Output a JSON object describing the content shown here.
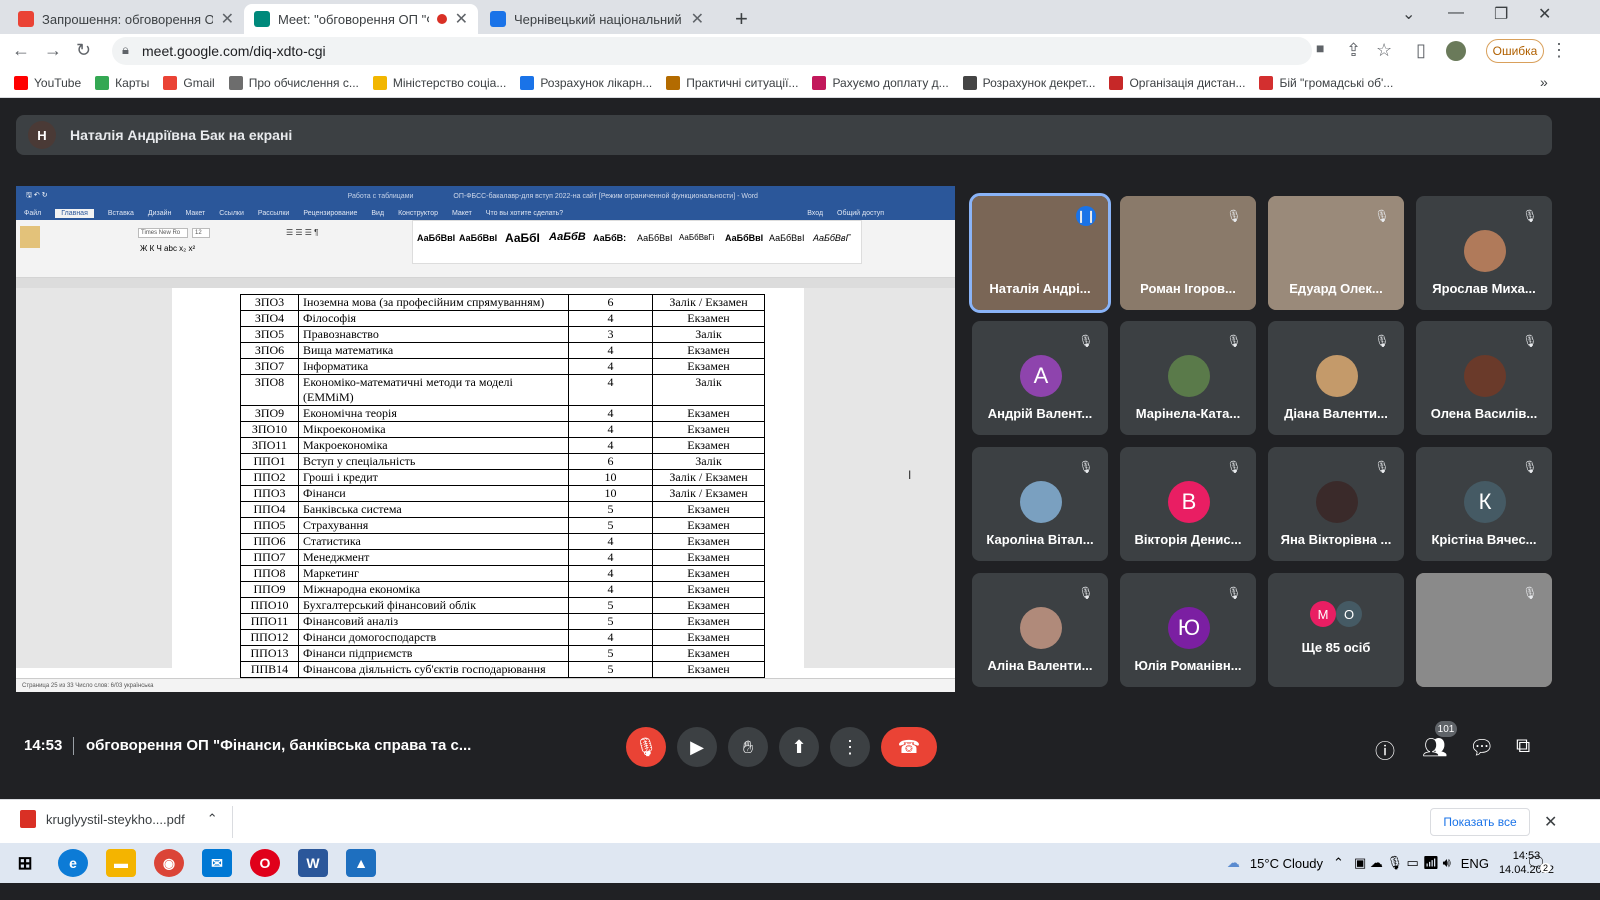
{
  "browser": {
    "tabs": [
      {
        "title": "Запрошення: обговорення ОП",
        "active": false,
        "favicon_color": "#ea4335"
      },
      {
        "title": "Meet: \"обговорення ОП \"Ф",
        "active": true,
        "favicon_color": "#00897b"
      },
      {
        "title": "Чернівецький національний ун",
        "active": false,
        "favicon_color": "#1a73e8"
      }
    ],
    "url": "meet.google.com/diq-xdto-cgi",
    "error_button": "Ошибка",
    "bookmarks": [
      {
        "label": "YouTube",
        "color": "#ff0000"
      },
      {
        "label": "Карты",
        "color": "#34a853"
      },
      {
        "label": "Gmail",
        "color": "#ea4335"
      },
      {
        "label": "Про обчислення с...",
        "color": "#6d6d6d"
      },
      {
        "label": "Міністерство соціа...",
        "color": "#f2b600"
      },
      {
        "label": "Розрахунок лікарн...",
        "color": "#1a73e8"
      },
      {
        "label": "Практичні ситуації...",
        "color": "#b36b00"
      },
      {
        "label": "Рахуємо доплату д...",
        "color": "#c2185b"
      },
      {
        "label": "Розрахунок декрет...",
        "color": "#444444"
      },
      {
        "label": "Організація дистан...",
        "color": "#c62828"
      },
      {
        "label": "Бій \"громадські об'...",
        "color": "#d32f2f"
      }
    ]
  },
  "meet": {
    "presenter_initial": "Н",
    "presenter_text": "Наталія Андріївна Бак на екрані",
    "time": "14:53",
    "meeting_title": "обговорення ОП \"Фінанси, банківська справа та с...",
    "people_count": "101",
    "participants": [
      {
        "name": "Наталія Андрі...",
        "type": "video",
        "initial": "",
        "color": "#7a6656"
      },
      {
        "name": "Роман Ігоров...",
        "type": "video",
        "initial": "",
        "color": "#8a7a6a"
      },
      {
        "name": "Едуард Олек...",
        "type": "video",
        "initial": "",
        "color": "#9a8a7a"
      },
      {
        "name": "Ярослав Миха...",
        "type": "photo",
        "initial": "",
        "color": "#b07a5a"
      },
      {
        "name": "Андрій Валент...",
        "type": "letter",
        "initial": "А",
        "color": "#8e44ad"
      },
      {
        "name": "Марінела-Ката...",
        "type": "photo",
        "initial": "",
        "color": "#5a7a4a"
      },
      {
        "name": "Діана Валенти...",
        "type": "photo",
        "initial": "",
        "color": "#c49a6a"
      },
      {
        "name": "Олена Василів...",
        "type": "photo",
        "initial": "",
        "color": "#6a3a2a"
      },
      {
        "name": "Кароліна Вітал...",
        "type": "photo",
        "initial": "",
        "color": "#7aa0c0"
      },
      {
        "name": "Вікторія Денис...",
        "type": "letter",
        "initial": "В",
        "color": "#e91e63"
      },
      {
        "name": "Яна Вікторівна ...",
        "type": "photo",
        "initial": "",
        "color": "#3a2a2a"
      },
      {
        "name": "Крістіна Вячес...",
        "type": "letter",
        "initial": "К",
        "color": "#455a64"
      },
      {
        "name": "Аліна Валенти...",
        "type": "photo",
        "initial": "",
        "color": "#b08a7a"
      },
      {
        "name": "Юлія Романівн...",
        "type": "letter",
        "initial": "Ю",
        "color": "#7b1fa2"
      },
      {
        "name": "Ще 85 осіб",
        "type": "more",
        "initial": "",
        "color": "#3c4043"
      },
      {
        "name": "",
        "type": "video",
        "initial": "",
        "color": "#8a8a8a"
      }
    ],
    "more_avatars": [
      "М",
      "О"
    ]
  },
  "word": {
    "title": "ОП-ФБСС-бакалавр-для вступ 2022-на сайт [Режим ограниченной функциональности] - Word",
    "context_tab": "Работа с таблицами",
    "ribbon_tabs": [
      "Файл",
      "Главная",
      "Вставка",
      "Дизайн",
      "Макет",
      "Ссылки",
      "Рассылки",
      "Рецензирование",
      "Вид",
      "Конструктор",
      "Макет"
    ],
    "search_hint": "Что вы хотите сделать?",
    "login": "Вход",
    "share": "Общий доступ",
    "font": "Times New Ro",
    "font_size": "12",
    "styles": [
      "АаБбВвІ",
      "АаБбВвІ",
      "АаБбІ",
      "АаБбВ",
      "АаБбВ:",
      "АаБбВвІ",
      "АаБбВвГі",
      "АаБбВвІ",
      "АаБбВвІ",
      "АаБбВвГ"
    ],
    "status": "Страница 25 из 33   Число слов: 6/03   українська",
    "rows": [
      [
        "ЗПО3",
        "Іноземна мова (за професійним спрямуванням)",
        "6",
        "Залік / Екзамен"
      ],
      [
        "ЗПО4",
        "Філософія",
        "4",
        "Екзамен"
      ],
      [
        "ЗПО5",
        "Правознавство",
        "3",
        "Залік"
      ],
      [
        "ЗПО6",
        "Вища математика",
        "4",
        "Екзамен"
      ],
      [
        "ЗПО7",
        "Інформатика",
        "4",
        "Екзамен"
      ],
      [
        "ЗПО8",
        "Економіко-математичні методи та моделі (ЕММіМ)",
        "4",
        "Залік"
      ],
      [
        "ЗПО9",
        "Економічна теорія",
        "4",
        "Екзамен"
      ],
      [
        "ЗПО10",
        "Мікроекономіка",
        "4",
        "Екзамен"
      ],
      [
        "ЗПО11",
        "Макроекономіка",
        "4",
        "Екзамен"
      ],
      [
        "ППО1",
        "Вступ у спеціальність",
        "6",
        "Залік"
      ],
      [
        "ППО2",
        "Гроші і кредит",
        "10",
        "Залік / Екзамен"
      ],
      [
        "ППО3",
        "Фінанси",
        "10",
        "Залік / Екзамен"
      ],
      [
        "ППО4",
        "Банківська система",
        "5",
        "Екзамен"
      ],
      [
        "ППО5",
        "Страхування",
        "5",
        "Екзамен"
      ],
      [
        "ППО6",
        "Статистика",
        "4",
        "Екзамен"
      ],
      [
        "ППО7",
        "Менеджмент",
        "4",
        "Екзамен"
      ],
      [
        "ППО8",
        "Маркетинг",
        "4",
        "Екзамен"
      ],
      [
        "ППО9",
        "Міжнародна економіка",
        "4",
        "Екзамен"
      ],
      [
        "ППО10",
        "Бухгалтерський фінансовий облік",
        "5",
        "Екзамен"
      ],
      [
        "ППО11",
        "Фінансовий аналіз",
        "5",
        "Екзамен"
      ],
      [
        "ППО12",
        "Фінанси домогосподарств",
        "4",
        "Екзамен"
      ],
      [
        "ППО13",
        "Фінанси підприємств",
        "5",
        "Екзамен"
      ],
      [
        "ППВ14",
        "Фінансова діяльність суб'єктів господарювання",
        "5",
        "Екзамен"
      ]
    ]
  },
  "downloads": {
    "file": "kruglyystil-steykho....pdf",
    "show_all": "Показать все"
  },
  "taskbar": {
    "weather": "15°C  Cloudy",
    "lang": "ENG",
    "time": "14:53",
    "date": "14.04.2022",
    "notifications": "2"
  }
}
